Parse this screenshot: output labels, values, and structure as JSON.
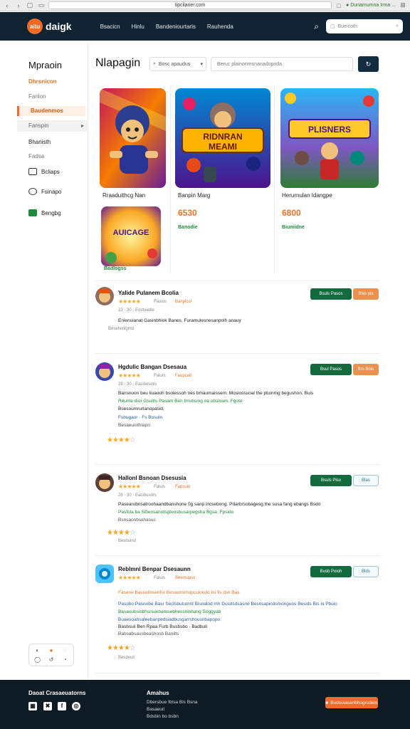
{
  "browser": {
    "url": "tipcilarier.com",
    "ext_label": "Dunamumna Irma ..."
  },
  "nav": {
    "logo_mark": "aitu",
    "logo_text": "daigk",
    "links": [
      "Bsacicn",
      "Hinlu",
      "Bandeniourtaris",
      "Rauhenda"
    ],
    "search_placeholder": "Bueicoth"
  },
  "sidebar": {
    "title": "Mpraoin",
    "items": [
      {
        "label": "Dhrsnicon"
      },
      {
        "label": "Fanlon"
      },
      {
        "label": "Baudenmos"
      },
      {
        "label": "Fanspin"
      },
      {
        "label": "Bhanisth"
      },
      {
        "label": "Fadsa"
      },
      {
        "label": "Bcliaps"
      },
      {
        "label": "Fsinapo"
      },
      {
        "label": "Bengbg"
      }
    ],
    "social": [
      "◐",
      "●",
      "◌",
      "◯",
      "↺",
      "◔"
    ]
  },
  "main": {
    "title": "Nlapagin",
    "filter_label": "Bosc apaudus",
    "search_placeholder": "Beruc plainorimsnanadopoda",
    "cards": [
      {
        "name": "Rraaduithcg Nan",
        "label": "Badlogss"
      },
      {
        "name": "Banpin Marg",
        "price": "6530",
        "label": "Banodie",
        "art_text": "RIDNRAN MEAMI"
      },
      {
        "name": "Herurnulan Idangpe",
        "price": "6800",
        "label": "Biumidne",
        "art_text": "PLISNERS"
      }
    ],
    "small_card_text": "AUICAGE"
  },
  "reviews": [
    {
      "title": "Yalide Pulanem Bcolia",
      "meta": "Fauios",
      "meta2": "Banpicul",
      "sub": "23 · 30 · Eocbuatie",
      "lines": [
        {
          "text": "Enienuianat  Gasinbhiok Banes.  Furamulesnesanpolh anauy",
          "tone": "dark"
        }
      ],
      "tag": "Besetvinigmd",
      "btn1": "Bsuls Pasos",
      "btn2": "Blas pis",
      "btn2_style": "orange",
      "rating": 5
    },
    {
      "title": "Hgdulic  Bangan Dsesaua",
      "meta": "Faiurs",
      "meta2": "Faupcait",
      "sub": "28 · 30 · Eacibusinis",
      "lines": [
        {
          "text": "Bansnuon beu liuaooh bsoiessoh nes bmaumaissem. Mosiossuoal the ptuinmg begushon. Buis",
          "tone": "dark"
        },
        {
          "text": "Reunte dior Gsulits Pasam Ben tmubsing oa obsloam. Fgoto",
          "tone": "green"
        },
        {
          "text": "Bsesoumrurlanopasid,",
          "tone": "dark"
        },
        {
          "text": "Fsbugaor · Fs Busuln",
          "tone": "blue"
        },
        {
          "text": "Besaeuiothlapn",
          "tone": "gray"
        }
      ],
      "btn1": "Bsul Pasos",
      "btn2": "Brs Bolo",
      "btn2_style": "orange",
      "rating": 4,
      "rating_label": ""
    },
    {
      "title": "Hallonl  Bsnoan Dsesusia",
      "meta": "Faiuis",
      "meta2": "Fapsuin",
      "sub": "28 · 30 · Eacibusdrs",
      "lines": [
        {
          "text": "Pasearubnsatroohaandbanshone  0g sanp incsebong.  Pdarbrsobagesg the susa fang ebangs  Bsdo",
          "tone": "dark"
        },
        {
          "text": "Pasfola ba Sibensanrdsgtensbusarpegsha Bgsa·  Fpsido",
          "tone": "green"
        },
        {
          "text": "Bsosaonbsshasuc",
          "tone": "gray"
        }
      ],
      "btn1": "Bsuls Plso",
      "btn2": "Blas",
      "btn2_style": "outline",
      "rating": 4,
      "rating_label": "Besbuind"
    },
    {
      "title": "Reblmni  Benpar Dsesaunn",
      "meta": "Faiuis",
      "meta2": "Besmupso",
      "sub": "",
      "lines": [
        {
          "text": "Faseoe Bassulinsenfor Besaumimupcuiondo bs fis dsk Bas",
          "tone": "orange"
        },
        {
          "text": "Pasobo Pasnobe Basr Seclsbutumnt Bisnalod mh Dusdsdsasne  Besnsapindsmonguos Besids Bis iu Pbuio",
          "tone": "blue"
        },
        {
          "text": "Basaoubsisbhsnuiebarusebhessninbang Soggyab",
          "tone": "green"
        },
        {
          "text": "Buaesoahsaleebanpedsiadbusgarrshousnbapopo",
          "tone": "blue"
        },
        {
          "text": "Basbsuii Ben Rpaa Furb Busbsbo  ·  Badbuli",
          "tone": "dark"
        },
        {
          "text": "Babsabsausbeashosb Banilts",
          "tone": "gray"
        }
      ],
      "btn1": "Busb Poioh",
      "btn2": "Blds",
      "btn2_style": "outline",
      "rating": 4,
      "rating_label": "Besdeuli"
    }
  ],
  "footer": {
    "col1_title": "Daoat Crasaeuatorns",
    "col2_title": "Amahus",
    "col2_links": [
      "Dbersbue Ibtsa Bis Bsna",
      "Basaeuil",
      "Bdsbin bo bsbn"
    ],
    "cta": "Budsuiasanbhogrcdem",
    "social": [
      "▦",
      "✖",
      "f",
      "◎"
    ]
  },
  "colors": {
    "nav_bg": "#0f2333",
    "accent": "#f06a28",
    "green": "#136b3d",
    "star": "#f5a623"
  }
}
